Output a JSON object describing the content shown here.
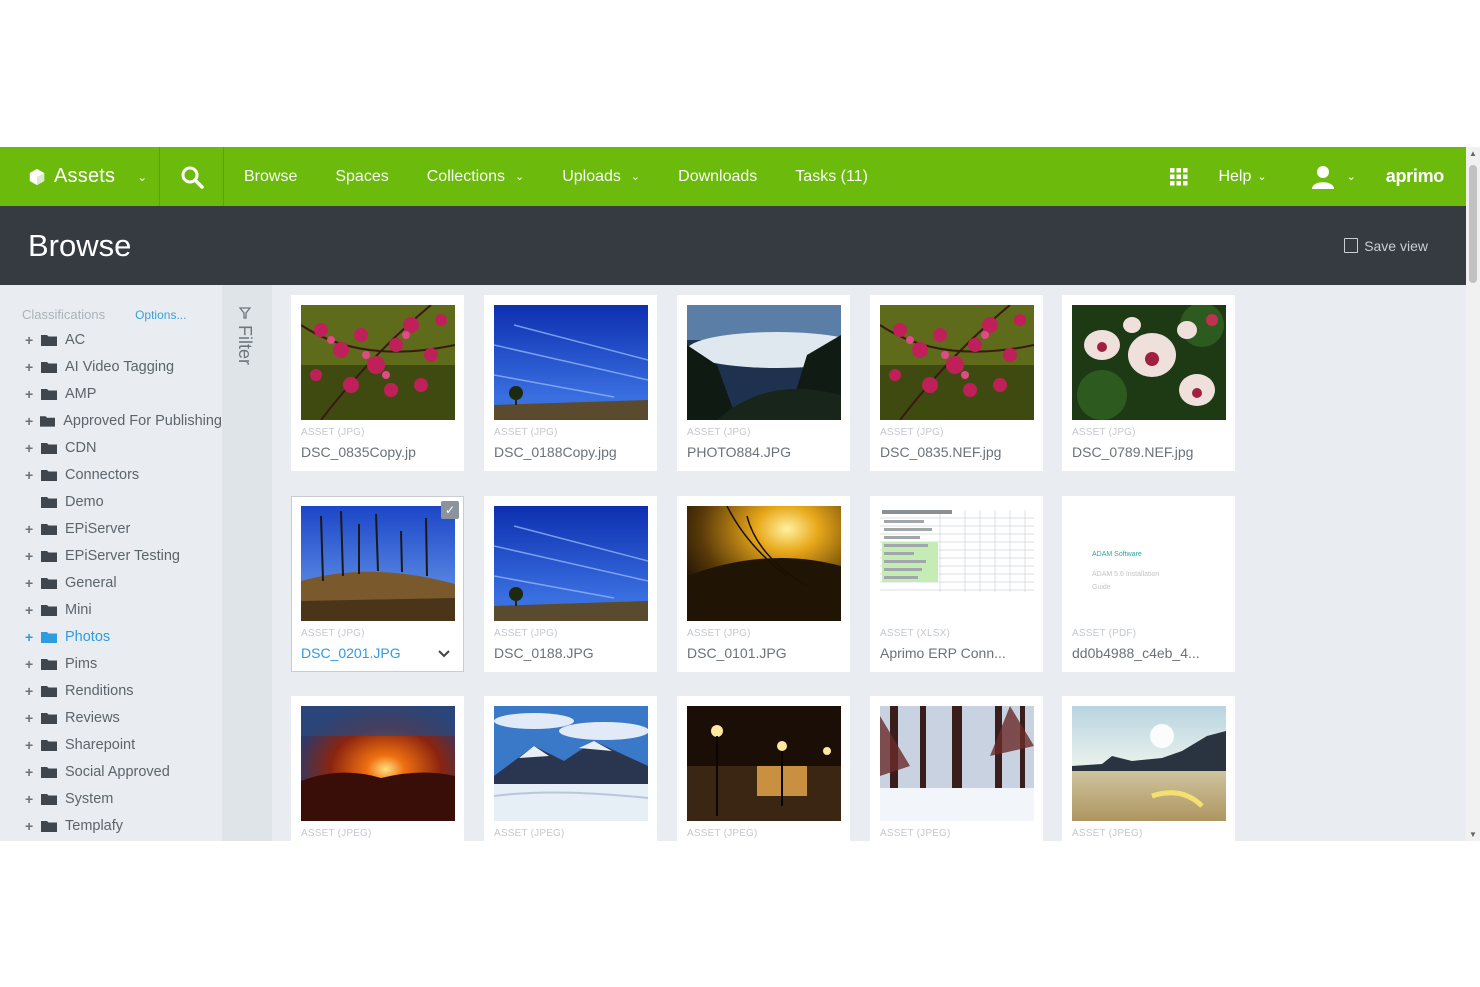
{
  "topbar": {
    "brand": "Assets",
    "nav": [
      "Browse",
      "Spaces",
      "Collections",
      "Uploads",
      "Downloads",
      "Tasks (11)"
    ],
    "nav_has_dropdown": [
      false,
      false,
      true,
      true,
      false,
      false
    ],
    "help": "Help",
    "logo": "aprimo",
    "color": "#6cba0c"
  },
  "header": {
    "title": "Browse",
    "save_view": "Save view"
  },
  "sidebar": {
    "heading": "Classifications",
    "options": "Options...",
    "filter": "Filter",
    "items": [
      {
        "label": "AC",
        "expand": true
      },
      {
        "label": "AI Video Tagging",
        "expand": true
      },
      {
        "label": "AMP",
        "expand": true
      },
      {
        "label": "Approved For Publishing",
        "expand": true
      },
      {
        "label": "CDN",
        "expand": true
      },
      {
        "label": "Connectors",
        "expand": true
      },
      {
        "label": "Demo",
        "expand": false
      },
      {
        "label": "EPiServer",
        "expand": true
      },
      {
        "label": "EPiServer Testing",
        "expand": true
      },
      {
        "label": "General",
        "expand": true
      },
      {
        "label": "Mini",
        "expand": true
      },
      {
        "label": "Photos",
        "expand": true,
        "active": true
      },
      {
        "label": "Pims",
        "expand": true
      },
      {
        "label": "Renditions",
        "expand": true
      },
      {
        "label": "Reviews",
        "expand": true
      },
      {
        "label": "Sharepoint",
        "expand": true
      },
      {
        "label": "Social Approved",
        "expand": true
      },
      {
        "label": "System",
        "expand": true
      },
      {
        "label": "Templafy",
        "expand": true
      }
    ]
  },
  "assets": [
    {
      "type": "ASSET (JPG)",
      "name": "DSC_0835Copy.jp",
      "thumb": "blossom"
    },
    {
      "type": "ASSET (JPG)",
      "name": "DSC_0188Copy.jpg",
      "thumb": "sky"
    },
    {
      "type": "ASSET (JPG)",
      "name": "PHOTO884.JPG",
      "thumb": "fog"
    },
    {
      "type": "ASSET (JPG)",
      "name": "DSC_0835.NEF.jpg",
      "thumb": "blossom"
    },
    {
      "type": "ASSET (JPG)",
      "name": "DSC_0789.NEF.jpg",
      "thumb": "magnolia"
    },
    {
      "type": "ASSET (JPG)",
      "name": "DSC_0201.JPG",
      "thumb": "trees",
      "selected": true
    },
    {
      "type": "ASSET (JPG)",
      "name": "DSC_0188.JPG",
      "thumb": "sky"
    },
    {
      "type": "ASSET (JPG)",
      "name": "DSC_0101.JPG",
      "thumb": "sunset"
    },
    {
      "type": "ASSET (XLSX)",
      "name": "Aprimo ERP Conn...",
      "thumb": "sheet"
    },
    {
      "type": "ASSET (PDF)",
      "name": "dd0b4988_c4eb_4...",
      "thumb": "pdf"
    },
    {
      "type": "ASSET (JPEG)",
      "name": "",
      "thumb": "sunburst"
    },
    {
      "type": "ASSET (JPEG)",
      "name": "",
      "thumb": "mountain"
    },
    {
      "type": "ASSET (JPEG)",
      "name": "",
      "thumb": "night"
    },
    {
      "type": "ASSET (JPEG)",
      "name": "",
      "thumb": "snowforest"
    },
    {
      "type": "ASSET (JPEG)",
      "name": "",
      "thumb": "lake"
    }
  ],
  "pdf_thumb": {
    "line1": "ADAM Software",
    "line2": "ADAM 5.6 Installation",
    "line3": "Guide"
  }
}
